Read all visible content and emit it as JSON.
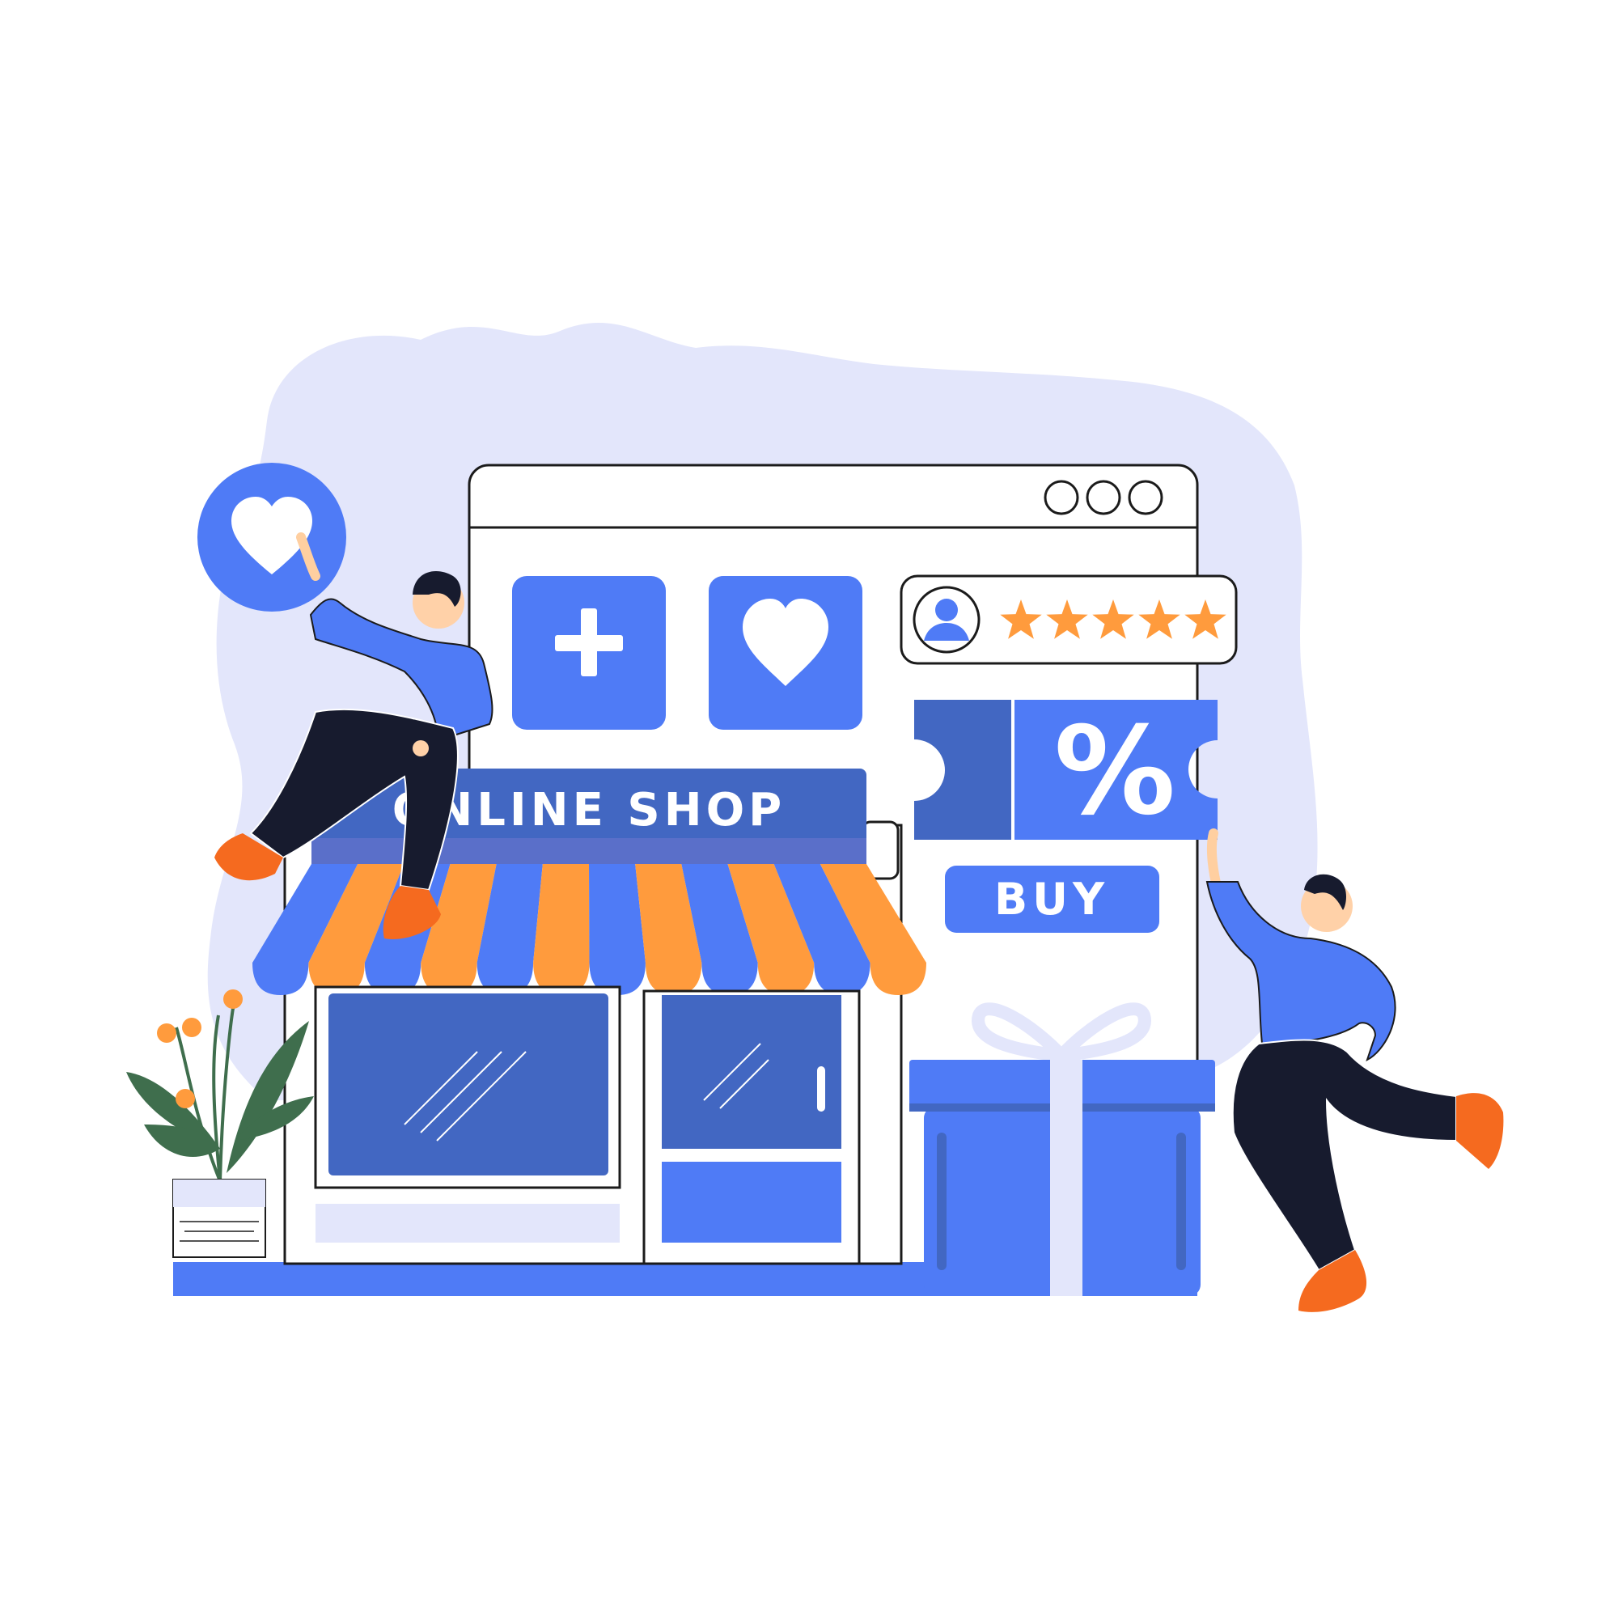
{
  "colors": {
    "background": "#ffffff",
    "blob": "#e3e6fb",
    "primary_blue": "#4f7bf6",
    "dark_blue": "#4267c2",
    "orange": "#ff9b3d",
    "dark_orange": "#f56a1f",
    "navy": "#171b2e",
    "leaf_green": "#3f6e4d",
    "white": "#ffffff",
    "outline": "#1b1b1b"
  },
  "shop": {
    "sign_text": "ONLINE SHOP"
  },
  "coupon": {
    "symbol": "%"
  },
  "buy_button": {
    "label": "BUY"
  },
  "review": {
    "rating": 5,
    "max_rating": 5
  },
  "icons": [
    "heart-icon",
    "plus-icon",
    "user-icon",
    "star-icon",
    "window-dots-icon"
  ]
}
